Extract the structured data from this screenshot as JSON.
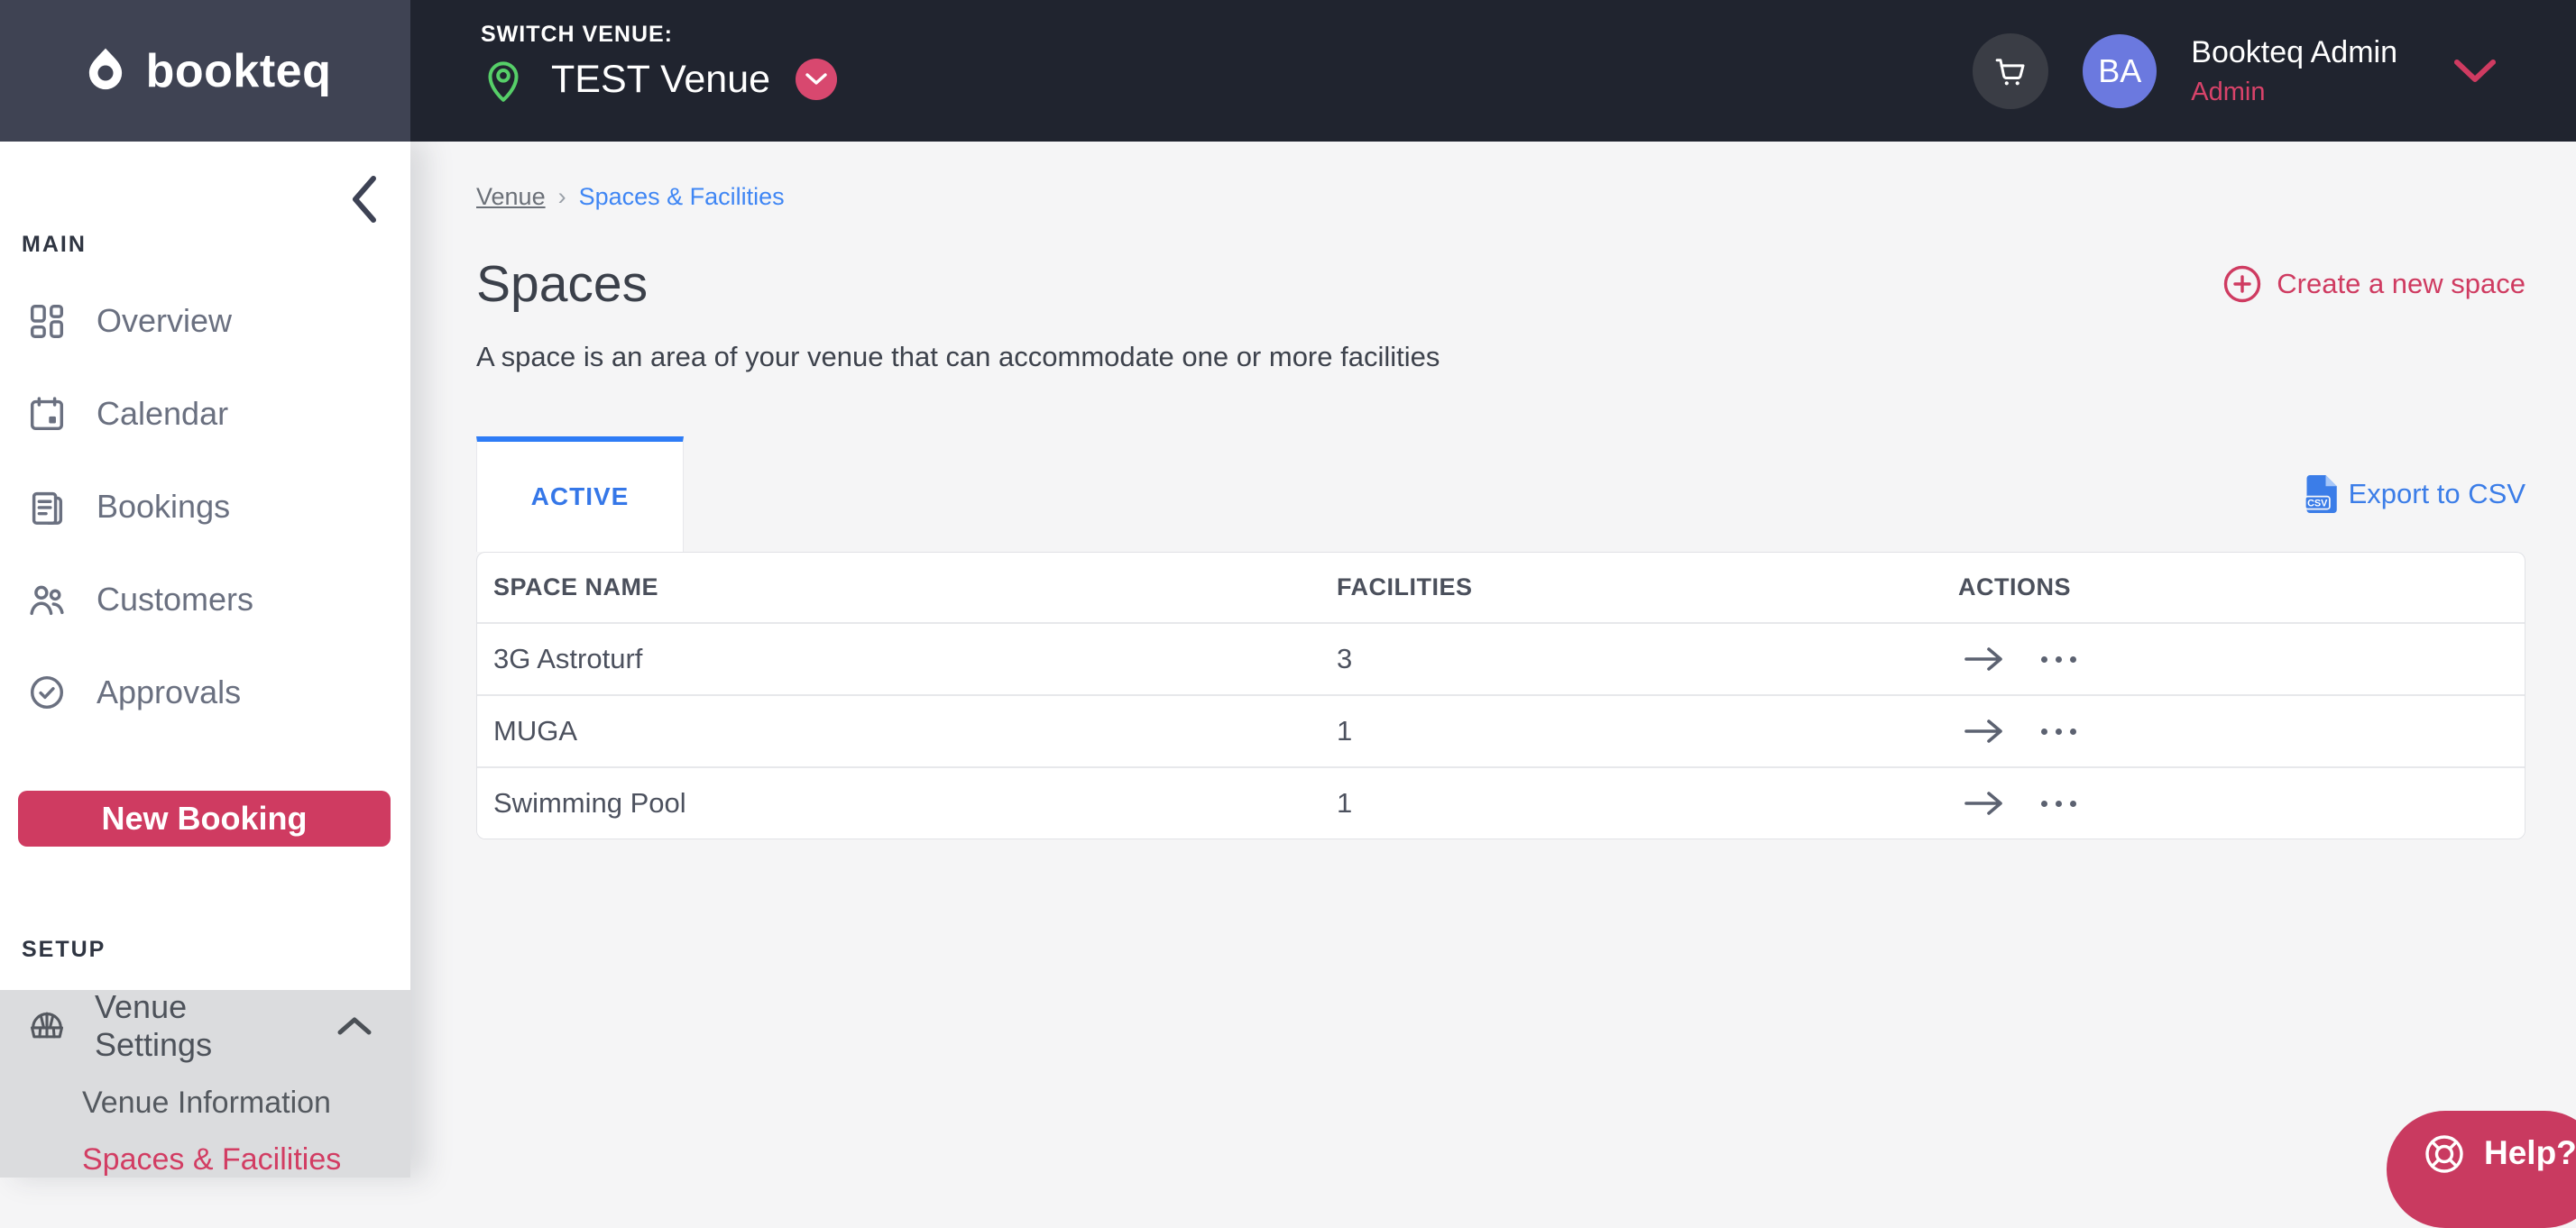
{
  "colors": {
    "accent_pink": "#cf3b61",
    "link_blue": "#3b7de8",
    "header_bg": "#20242f",
    "logo_bg": "#3f4353",
    "avatar_bg": "#6b79df",
    "pin_green": "#56cf68",
    "submenu_bg": "#dbdcde"
  },
  "icons": {
    "brand": "droplet-icon",
    "venue": "map-pin-icon",
    "header": [
      "cart-icon",
      "chevron-down-icon"
    ],
    "sidebar": [
      "chevron-left-icon",
      "grid-icon",
      "calendar-icon",
      "bookings-icon",
      "customers-icon",
      "check-circle-icon",
      "stadium-icon",
      "chevron-up-icon"
    ],
    "main": [
      "plus-circle-icon",
      "csv-file-icon",
      "arrow-right-icon",
      "more-actions-icon",
      "lifebuoy-icon"
    ]
  },
  "header": {
    "brand": "bookteq",
    "switch_venue_label": "SWITCH VENUE:",
    "venue_name": "TEST Venue",
    "user": {
      "initials": "BA",
      "name": "Bookteq Admin",
      "role": "Admin"
    }
  },
  "sidebar": {
    "main_label": "MAIN",
    "items": [
      {
        "label": "Overview"
      },
      {
        "label": "Calendar"
      },
      {
        "label": "Bookings"
      },
      {
        "label": "Customers"
      },
      {
        "label": "Approvals"
      }
    ],
    "new_booking_label": "New Booking",
    "setup_label": "SETUP",
    "venue_settings": {
      "label": "Venue Settings",
      "children": [
        {
          "label": "Venue Information"
        },
        {
          "label": "Spaces & Facilities"
        }
      ]
    }
  },
  "main": {
    "breadcrumb": {
      "root": "Venue",
      "separator": "›",
      "current": "Spaces & Facilities"
    },
    "title": "Spaces",
    "subtitle": "A space is an area of your venue that can accommodate one or more facilities",
    "create_label": "Create a new space",
    "tab_label": "ACTIVE",
    "export_label": "Export to CSV",
    "csv_badge": "CSV",
    "table": {
      "columns": [
        "SPACE NAME",
        "FACILITIES",
        "ACTIONS"
      ],
      "rows": [
        {
          "name": "3G Astroturf",
          "facilities": "3"
        },
        {
          "name": "MUGA",
          "facilities": "1"
        },
        {
          "name": "Swimming Pool",
          "facilities": "1"
        }
      ]
    }
  },
  "help_label": "Help?"
}
